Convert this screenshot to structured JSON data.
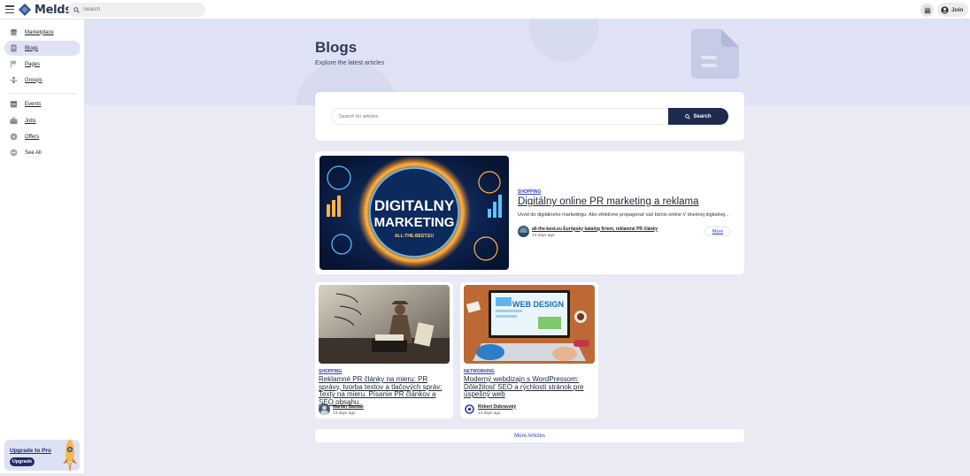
{
  "header": {
    "logo_text": "Melds",
    "search_placeholder": "Search",
    "join_label": "Join"
  },
  "sidebar": {
    "items": [
      {
        "label": "Marketplace",
        "icon": "store-icon"
      },
      {
        "label": "Blogs",
        "icon": "document-icon",
        "active": true
      },
      {
        "label": "Pages",
        "icon": "flag-icon"
      },
      {
        "label": "Groups",
        "icon": "group-icon"
      },
      {
        "label": "Events",
        "icon": "calendar-icon"
      },
      {
        "label": "Jobs",
        "icon": "briefcase-icon"
      },
      {
        "label": "Offers",
        "icon": "tag-icon"
      },
      {
        "label": "See All",
        "icon": "grid-icon"
      }
    ],
    "upgrade_title": "Upgrade to Pro",
    "upgrade_button": "Upgrade"
  },
  "hero": {
    "title": "Blogs",
    "subtitle": "Explore the latest articles"
  },
  "search_card": {
    "placeholder": "Search for articles",
    "button_label": "Search"
  },
  "featured": {
    "image_text_main": "DIGITALNY",
    "image_text_second": "MARKETING",
    "image_text_url": "ALL-THE-BEST.EU",
    "category": "SHOPPING",
    "title": "Digitálny online PR marketing a reklama",
    "excerpt": "Úvod do digitálneho marketingu: Ako efektívne propagovať váš biznis online V dnešnej digitálnej...",
    "author": "all-the-best.eu Európsky katalóg firiem, reklamné PR články",
    "time": "13 days ago",
    "more_label": "More"
  },
  "articles": [
    {
      "category": "SHOPPING",
      "title": "Reklamné PR články na mieru: PR správy, tvorba textov a tlačových správ: Texty na mieru. Písanie PR článkov a SEO obsahu.",
      "author": "Marián Sassak",
      "time": "13 days ago"
    },
    {
      "category": "NETWORKING",
      "title": "Moderný webdizajn s WordPressom: Dôležitosť SEO a rýchlosti stránok pre úspešný web",
      "image_text": "WEB DESIGN",
      "author": "Róbert Dúbravský",
      "time": "13 days ago"
    }
  ],
  "more_articles_label": "More Articles",
  "colors": {
    "accent": "#2b3fc4",
    "dark_button": "#1e2b4f",
    "hero_bg": "#dfe2f4",
    "page_bg": "#e9eaf3"
  }
}
